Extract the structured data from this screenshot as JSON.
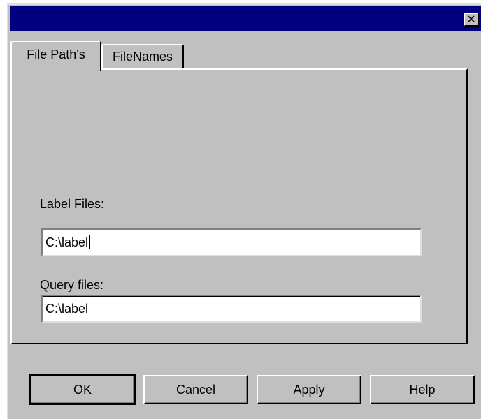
{
  "window": {
    "close_glyph": "✕"
  },
  "tabs": [
    {
      "label": "File Path's",
      "active": true
    },
    {
      "label": "FileNames",
      "active": false
    }
  ],
  "fields": {
    "label_files": {
      "label": "Label Files:",
      "value": "C:\\label"
    },
    "query_files": {
      "label": "Query files:",
      "value": "C:\\label"
    }
  },
  "buttons": {
    "ok": "OK",
    "cancel": "Cancel",
    "apply_mnemonic": "A",
    "apply_rest": "pply",
    "help": "Help"
  },
  "colors": {
    "titlebar": "#000080",
    "face": "#c0c0c0"
  }
}
